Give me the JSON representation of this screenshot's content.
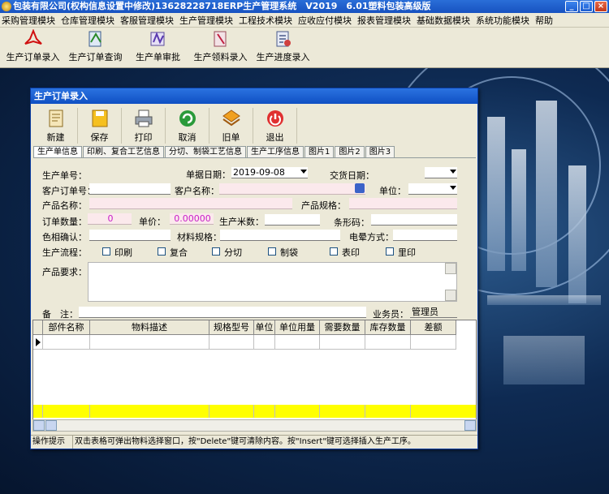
{
  "window": {
    "title": "包装有限公司(权构信息设置中修改)13628228718ERP生产管理系统　V2019　6.01塑料包装高级版",
    "min": "_",
    "max": "□",
    "close": "×"
  },
  "menu": [
    "采购管理模块",
    "仓库管理模块",
    "客服管理模块",
    "生产管理模块",
    "工程技术模块",
    "应收应付模块",
    "报表管理模块",
    "基础数据模块",
    "系统功能模块",
    "帮助"
  ],
  "main_toolbar": [
    {
      "label": "生产订单录入",
      "icon": "pdf-icon"
    },
    {
      "label": "生产订单查询",
      "icon": "query-icon"
    },
    {
      "label": "生产单审批",
      "icon": "approve-icon"
    },
    {
      "label": "生产领料录入",
      "icon": "material-icon"
    },
    {
      "label": "生产进度录入",
      "icon": "progress-icon"
    }
  ],
  "dialog": {
    "title": "生产订单录入",
    "toolbar": [
      {
        "label": "新建",
        "icon": "new-doc-icon"
      },
      {
        "label": "保存",
        "icon": "save-icon"
      },
      {
        "label": "打印",
        "icon": "print-icon"
      },
      {
        "label": "取消",
        "icon": "cancel-icon"
      },
      {
        "label": "旧单",
        "icon": "old-order-icon"
      },
      {
        "label": "退出",
        "icon": "exit-icon"
      }
    ],
    "tabs": [
      "生产单信息",
      "印刷、复合工艺信息",
      "分切、制袋工艺信息",
      "生产工序信息",
      "图片1",
      "图片2",
      "图片3"
    ],
    "form": {
      "order_no_label": "生产单号：",
      "doc_date_label": "单据日期：",
      "doc_date_value": "2019-09-08",
      "delivery_date_label": "交货日期：",
      "cust_order_label": "客户订单号：",
      "cust_name_label": "客户名称：",
      "unit_label": "单位：",
      "product_name_label": "产品名称：",
      "product_spec_label": "产品规格：",
      "qty_label": "订单数量：",
      "qty_value": "0",
      "price_label": "单价：",
      "price_value": "0.00000",
      "meters_label": "生产米数：",
      "barcode_label": "条形码：",
      "color_label": "色相确认：",
      "material_spec_label": "材料规格：",
      "corona_label": "电晕方式：",
      "process_label": "生产流程：",
      "process_options": [
        "印刷",
        "复合",
        "分切",
        "制袋",
        "表印",
        "里印"
      ],
      "requirement_label": "产品要求：",
      "remark_label": "备　注：",
      "salesman_label": "业务员：",
      "salesman_value": "管理员"
    },
    "grid_columns": [
      "部件名称",
      "物料描述",
      "规格型号",
      "单位",
      "单位用量",
      "需要数量",
      "库存数量",
      "差额"
    ],
    "status": {
      "label": "操作提示",
      "text": "双击表格可弹出物料选择窗口，按\"Delete\"键可清除内容。按\"Insert\"键可选择插入生产工序。"
    }
  }
}
